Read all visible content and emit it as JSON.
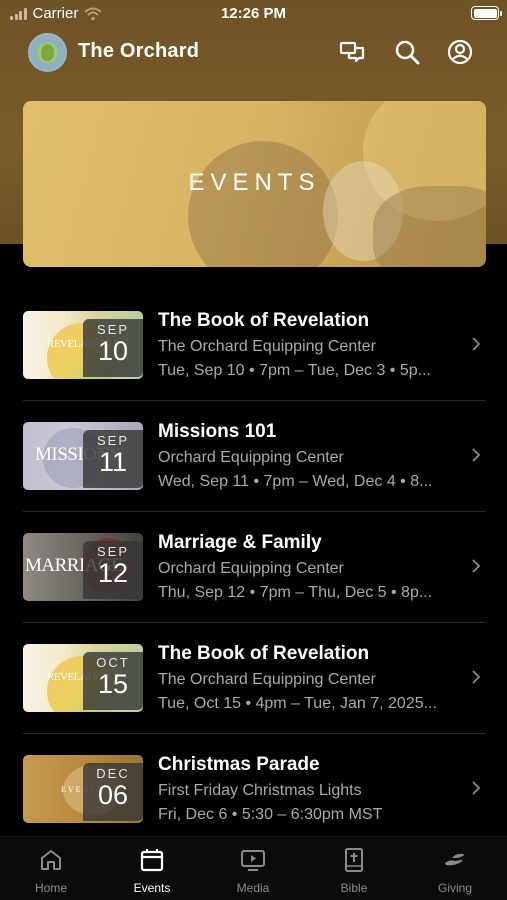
{
  "status_bar": {
    "carrier": "Carrier",
    "time": "12:26 PM"
  },
  "header": {
    "app_title": "The Orchard"
  },
  "banner": {
    "title": "EVENTS"
  },
  "events": [
    {
      "title": "The Book of Revelation",
      "location": "The Orchard Equipping Center",
      "when": "Tue, Sep 10 • 7pm – Tue, Dec 3 • 5p...",
      "month": "SEP",
      "day": "10",
      "thumb_text": "REVELATION"
    },
    {
      "title": "Missions 101",
      "location": "Orchard Equipping Center",
      "when": "Wed, Sep 11 • 7pm – Wed, Dec 4 • 8...",
      "month": "SEP",
      "day": "11",
      "thumb_text": "MISSIONS"
    },
    {
      "title": "Marriage & Family",
      "location": "Orchard Equipping Center",
      "when": "Thu, Sep 12 • 7pm – Thu, Dec 5 • 8p...",
      "month": "SEP",
      "day": "12",
      "thumb_text": "MARRIAGE"
    },
    {
      "title": "The Book of Revelation",
      "location": "The Orchard Equipping Center",
      "when": "Tue, Oct 15 • 4pm – Tue, Jan 7, 2025...",
      "month": "OCT",
      "day": "15",
      "thumb_text": "REVELATION"
    },
    {
      "title": "Christmas Parade",
      "location": "First Friday Christmas Lights",
      "when": "Fri, Dec 6 • 5:30 – 6:30pm MST",
      "month": "DEC",
      "day": "06",
      "thumb_text": "EVENTS"
    }
  ],
  "tabs": [
    {
      "label": "Home",
      "icon": "home-icon",
      "active": false
    },
    {
      "label": "Events",
      "icon": "calendar-icon",
      "active": true
    },
    {
      "label": "Media",
      "icon": "tv-play-icon",
      "active": false
    },
    {
      "label": "Bible",
      "icon": "bible-icon",
      "active": false
    },
    {
      "label": "Giving",
      "icon": "giving-hand-icon",
      "active": false
    }
  ],
  "colors": {
    "header_bg": "#7a5c2a",
    "banner_gold": "#d9b564",
    "background": "#000000",
    "secondary_text": "#a9a9a9"
  }
}
